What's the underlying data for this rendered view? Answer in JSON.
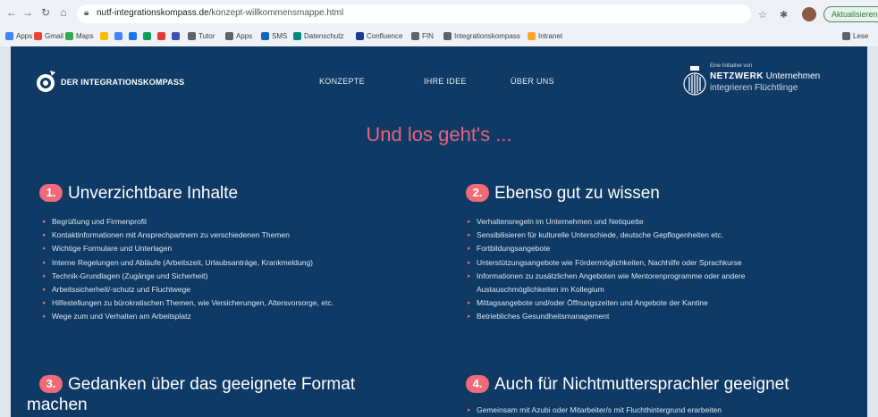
{
  "browser": {
    "url_host": "nutf-integrationskompass.de",
    "url_path": "/konzept-willkommensmappe.html",
    "update_label": "Aktualisieren",
    "bookmarks": [
      {
        "label": "Apps",
        "color": "#4285f4"
      },
      {
        "label": "Gmail",
        "color": "#ea4335"
      },
      {
        "label": "Maps",
        "color": "#34a853"
      },
      {
        "label": "",
        "color": "#fbbc05"
      },
      {
        "label": "",
        "color": "#4285f4"
      },
      {
        "label": "",
        "color": "#1a73e8"
      },
      {
        "label": "",
        "color": "#0f9d58"
      },
      {
        "label": "",
        "color": "#e53935"
      },
      {
        "label": "",
        "color": "#3f51b5"
      },
      {
        "label": "Tutor",
        "color": "#5f6368"
      },
      {
        "label": "Apps",
        "color": "#5f6368"
      },
      {
        "label": "SMS",
        "color": "#1565c0"
      },
      {
        "label": "Datenschutz",
        "color": "#00897b"
      },
      {
        "label": "Confluence",
        "color": "#1e3a8a"
      },
      {
        "label": "FIN",
        "color": "#5f6368"
      },
      {
        "label": "Integrationskompass",
        "color": "#5f6368"
      },
      {
        "label": "Intranet",
        "color": "#f9a825"
      }
    ],
    "reading_list": "Lese"
  },
  "site": {
    "logo_text": "DER INTEGRATIONSKOMPASS",
    "nav": [
      "KONZEPTE",
      "IHRE IDEE",
      "ÜBER UNS"
    ],
    "partner_small": "Eine Initiative von",
    "partner_bold": "NETZWERK",
    "partner_main_rest": "Unternehmen",
    "partner_sub": "integrieren Flüchtlinge",
    "headline": "Und los geht's ...",
    "sections": [
      {
        "num": "1.",
        "title": "Unverzichtbare Inhalte",
        "items": [
          "Begrüßung und Firmenprofil",
          "Kontaktinformationen mit Ansprechpartnern zu verschiedenen Themen",
          "Wichtige Formulare und Unterlagen",
          "Interne Regelungen und Abläufe (Arbeitszeit, Urlaubsanträge, Krankmeldung)",
          "Technik-Grundlagen (Zugänge und Sicherheit)",
          "Arbeitssicherheit/-schutz und Fluchtwege",
          "Hilfestellungen zu bürokratischen Themen, wie Versicherungen, Altersvorsorge, etc.",
          "Wege zum und Verhalten am Arbeitsplatz"
        ]
      },
      {
        "num": "2.",
        "title": "Ebenso gut zu wissen",
        "items": [
          "Verhaltensregeln im Unternehmen und Netiquette",
          "Sensibilisieren für kulturelle Unterschiede, deutsche Gepflogenheiten etc.",
          "Fortbildungsangebote",
          "Unterstützungsangebote wie Fördermöglichkeiten, Nachhilfe oder Sprachkurse",
          "Informationen zu zusätzlichen Angeboten wie Mentorenprogramme oder andere",
          "Mittagsangebote und/oder Öffnungszeiten und Angebote der Kantine",
          "Betriebliches Gesundheitsmanagement"
        ],
        "item5_cont": "Austauschmöglichkeiten im Kollegium"
      },
      {
        "num": "3.",
        "title_line1": "Gedanken über das geeignete Format",
        "title_line2": "machen"
      },
      {
        "num": "4.",
        "title": "Auch für Nichtmuttersprachler geeignet",
        "items": [
          "Gemeinsam mit Azubi oder Mitarbeiter/s mit Fluchthintergrund erarbeiten"
        ]
      }
    ]
  },
  "colors": {
    "background": "#0f3a66",
    "accent": "#f06a78",
    "headline": "#e8637a"
  }
}
